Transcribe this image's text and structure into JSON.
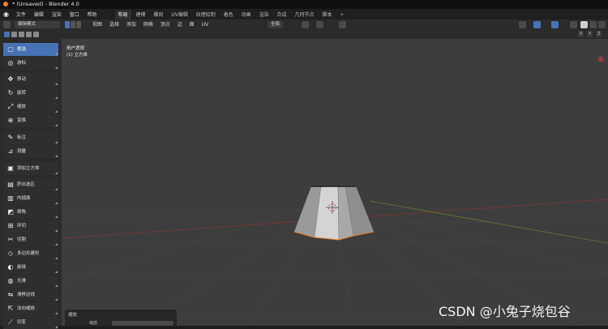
{
  "window": {
    "title": "* (Unsaved) - Blender 4.0"
  },
  "menu": {
    "items": [
      "文件",
      "编辑",
      "渲染",
      "窗口",
      "帮助"
    ],
    "workspaces": [
      "布局",
      "建模",
      "雕刻",
      "UV编辑",
      "纹理绘制",
      "着色",
      "动画",
      "渲染",
      "合成",
      "几何节点",
      "脚本"
    ],
    "active_workspace": "布局",
    "add_label": "+"
  },
  "header": {
    "mode": "编辑模式",
    "view_menu": [
      "视图",
      "选择",
      "添加",
      "网格",
      "顶点",
      "边",
      "面",
      "UV"
    ],
    "transform_orientation": "全局"
  },
  "subheader": {
    "axes": [
      "X",
      "Y",
      "Z"
    ]
  },
  "tools": [
    {
      "label": "框选",
      "icon": "select-box-icon",
      "active": true
    },
    {
      "label": "游标",
      "icon": "cursor-icon"
    },
    {
      "label": "移动",
      "icon": "move-icon"
    },
    {
      "label": "旋转",
      "icon": "rotate-icon"
    },
    {
      "label": "缩放",
      "icon": "scale-icon"
    },
    {
      "label": "变换",
      "icon": "transform-icon"
    },
    {
      "label": "标注",
      "icon": "annotate-icon"
    },
    {
      "label": "测量",
      "icon": "measure-icon"
    },
    {
      "label": "添加立方体",
      "icon": "add-cube-icon"
    },
    {
      "label": "挤出选区",
      "icon": "extrude-icon"
    },
    {
      "label": "内插面",
      "icon": "inset-icon"
    },
    {
      "label": "倒角",
      "icon": "bevel-icon"
    },
    {
      "label": "环切",
      "icon": "loop-cut-icon"
    },
    {
      "label": "切割",
      "icon": "knife-icon"
    },
    {
      "label": "多边形建形",
      "icon": "poly-build-icon"
    },
    {
      "label": "旋绕",
      "icon": "spin-icon"
    },
    {
      "label": "光滑",
      "icon": "smooth-icon"
    },
    {
      "label": "滑移边线",
      "icon": "edge-slide-icon"
    },
    {
      "label": "法向缩放",
      "icon": "shrink-fatten-icon"
    },
    {
      "label": "切变",
      "icon": "shear-icon"
    }
  ],
  "viewport": {
    "view_name": "用户透视",
    "object_name": "(1) 立方体",
    "background": "#3d3d3d",
    "mesh_color": "#b8b8b8",
    "selection_color": "#e8832a"
  },
  "operator_panel": {
    "title": "缩放",
    "field_label": "缩放"
  },
  "watermark": "CSDN @小兔子烧包谷"
}
